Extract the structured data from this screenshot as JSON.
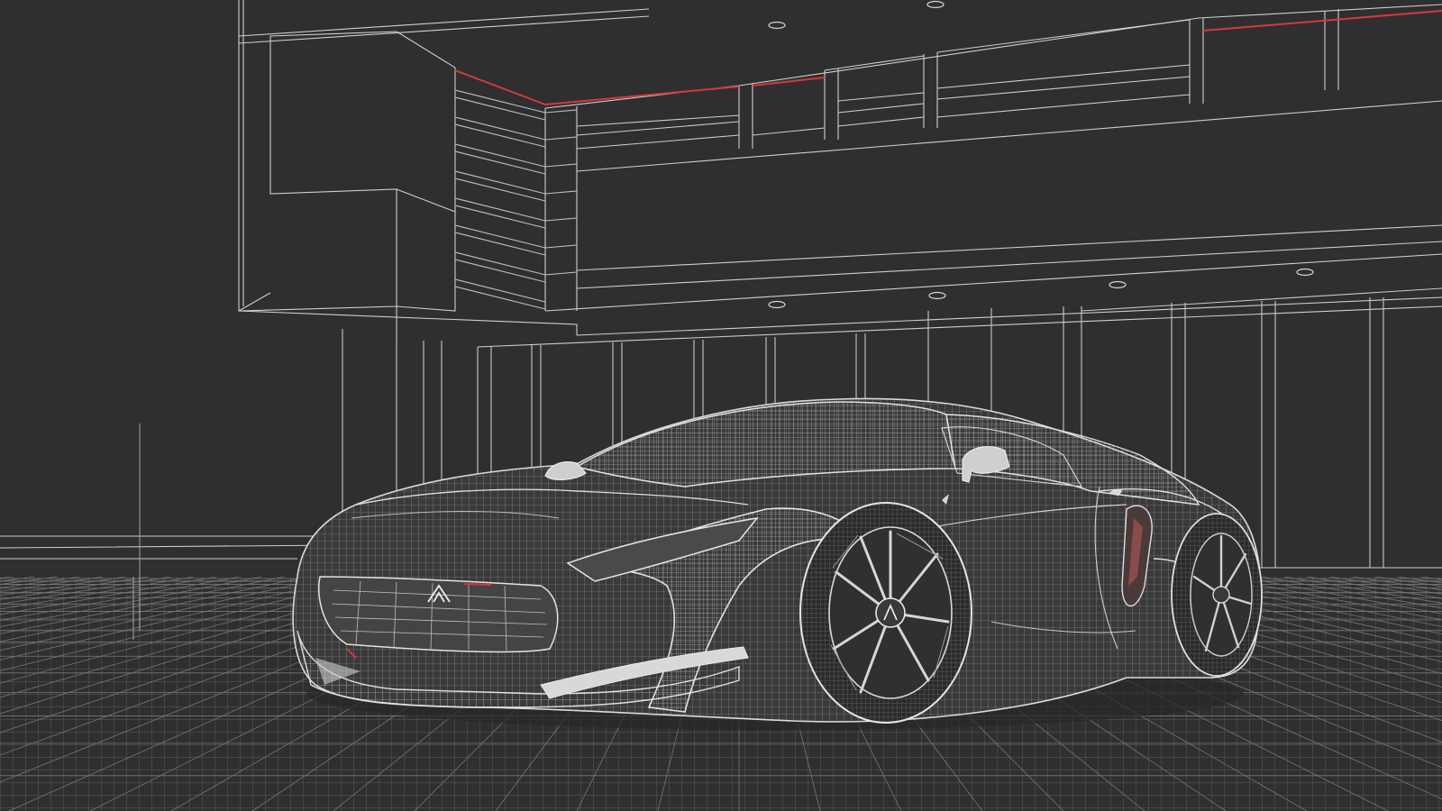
{
  "scene": {
    "subject": "",
    "style": "",
    "colors": {
      "background": "#2f2f2f",
      "wire": "#d8d8d8",
      "wire_dim": "#8a8a8a",
      "wire_faint": "#5e5e5e",
      "accent": "#d23a3a",
      "car_fill": "#3a3a3a"
    },
    "icons": [
      "car-logo-icon",
      "wheel-center-logo-icon",
      "ceiling-spotlight-icon"
    ]
  }
}
